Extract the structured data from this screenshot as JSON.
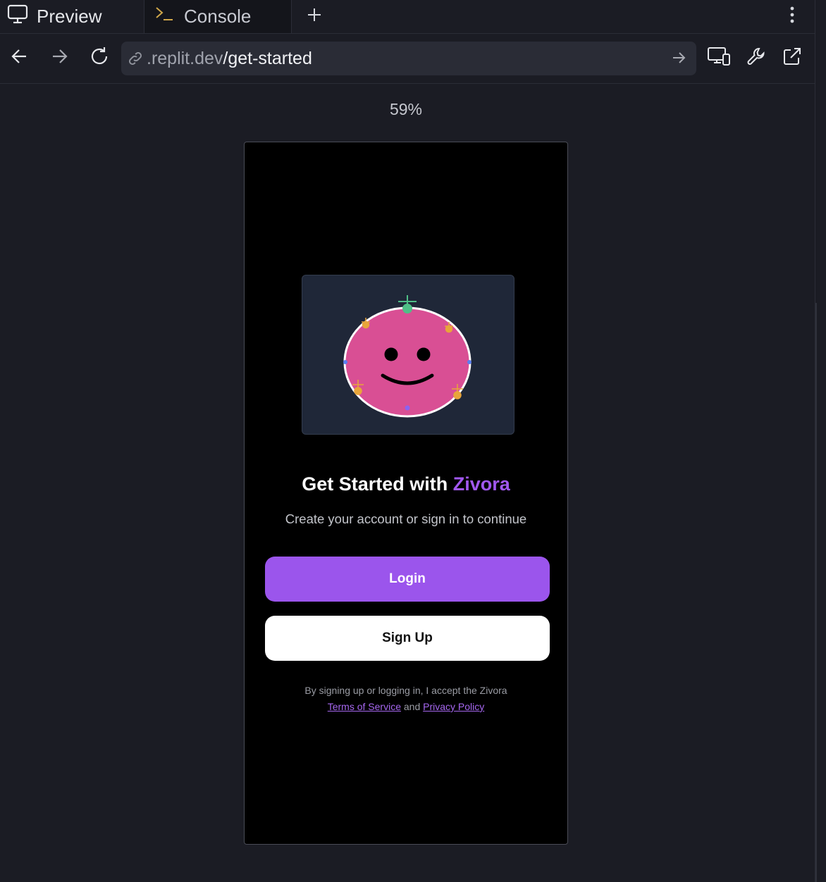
{
  "tabs": [
    {
      "label": "Preview",
      "icon": "monitor-icon",
      "active": true
    },
    {
      "label": "Console",
      "icon": "terminal-icon",
      "active": false
    }
  ],
  "tabbar": {
    "add_icon": "plus-icon",
    "more_icon": "kebab-menu-icon"
  },
  "navbar": {
    "url_host": ".replit.dev",
    "url_path": "/get-started",
    "icons": [
      "back-arrow-icon",
      "forward-arrow-icon",
      "reload-icon",
      "link-icon",
      "go-arrow-icon",
      "devices-icon",
      "devtools-wrench-icon",
      "open-external-icon"
    ]
  },
  "zoom_label": "59%",
  "app": {
    "title_prefix": "Get Started with ",
    "title_brand": "Zivora",
    "subtitle": "Create your account or sign in to continue",
    "login_label": "Login",
    "signup_label": "Sign Up",
    "legal_line1": "By signing up or logging in, I accept the Zivora",
    "terms_link": "Terms of Service",
    "legal_and": " and ",
    "privacy_link": "Privacy Policy"
  },
  "colors": {
    "accent": "#9b55ec",
    "brand_text": "#a158ef",
    "mascot_pink": "#d94f94",
    "sprout_green": "#4fbf87",
    "spark_orange": "#e8a53a"
  }
}
